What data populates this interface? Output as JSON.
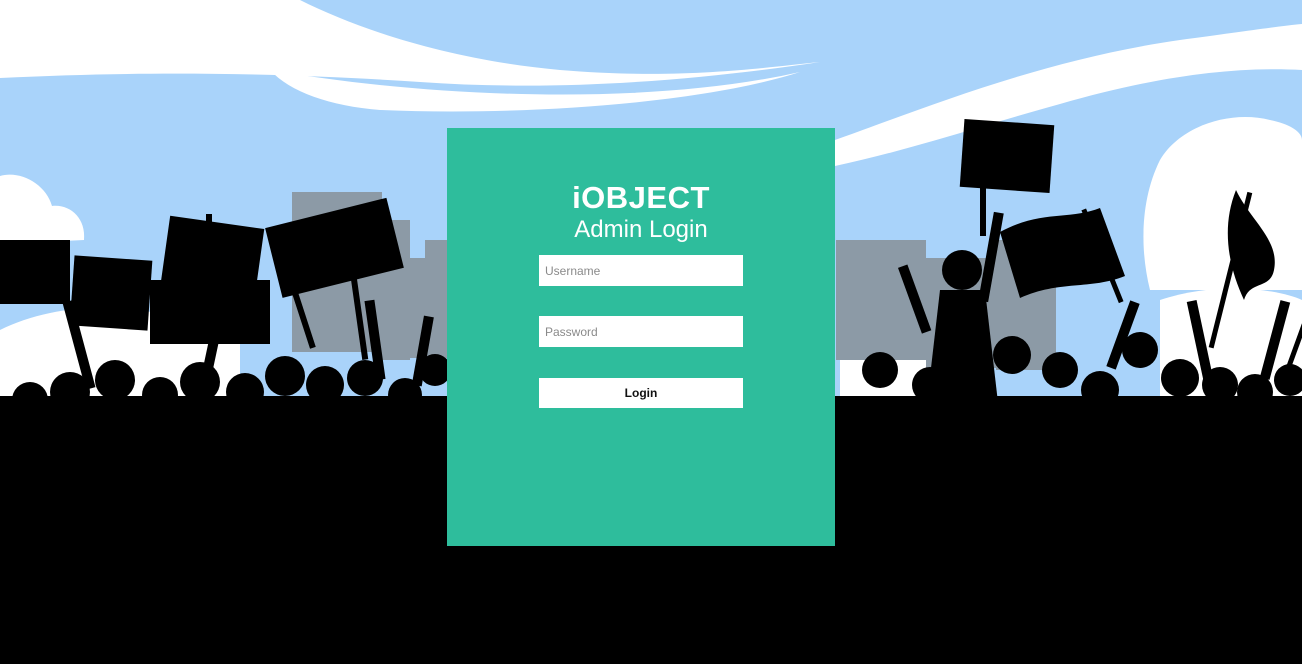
{
  "login": {
    "title": "iOBJECT",
    "subtitle": "Admin Login",
    "username_placeholder": "Username",
    "password_placeholder": "Password",
    "submit_label": "Login"
  },
  "colors": {
    "panel": "#2ebd9c",
    "sky": "#a9d3fa",
    "cloud": "#ffffff",
    "buildings": "#8c9aa6",
    "crowd": "#000000"
  }
}
